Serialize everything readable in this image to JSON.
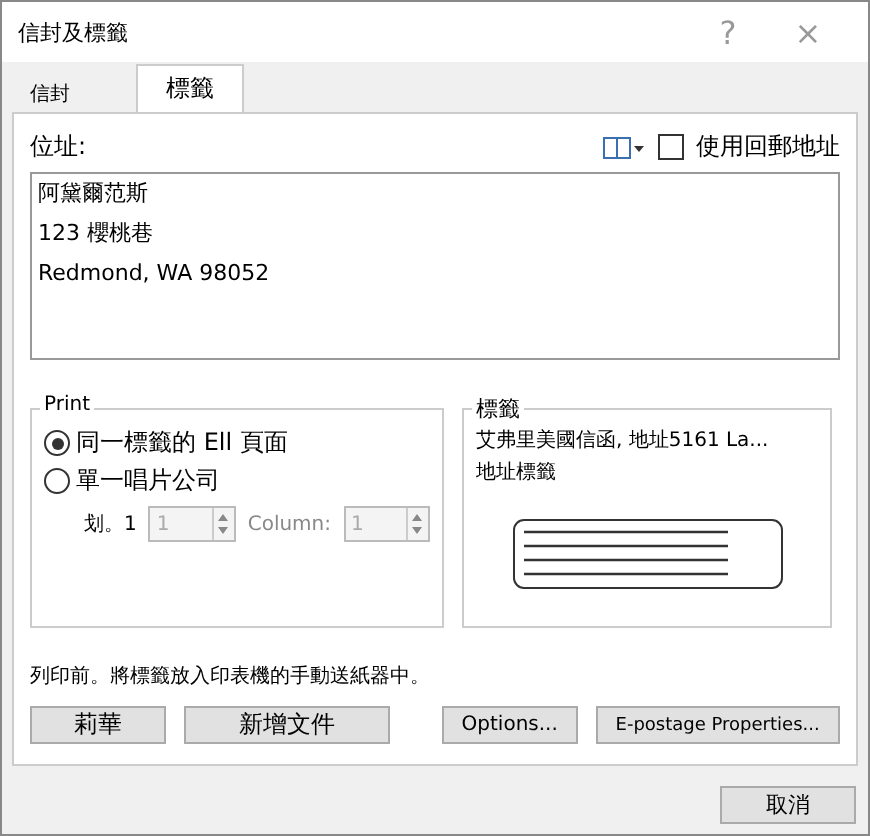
{
  "window": {
    "title": "信封及標籤",
    "help": "?",
    "close": "×"
  },
  "tabs": [
    {
      "label": "信封",
      "selected": false
    },
    {
      "label": "標籤",
      "selected": true
    }
  ],
  "address": {
    "label": "位址:",
    "use_return_address": {
      "label": "使用回郵地址",
      "checked": false
    },
    "lines": [
      "阿黛爾范斯",
      "123 櫻桃巷",
      "Redmond, WA 98052"
    ]
  },
  "print": {
    "title": "Print",
    "options": [
      {
        "label": "同一標籤的 Ell 頁面",
        "selected": true
      },
      {
        "label": "單一唱片公司",
        "selected": false
      }
    ],
    "row": {
      "label": "划。1",
      "value": "1",
      "disabled": true
    },
    "column": {
      "label": "Column:",
      "value": "1",
      "disabled": true
    }
  },
  "label_preview": {
    "title": "標籤",
    "vendor": "艾弗里美國信函, 地址5161 La...",
    "type": "地址標籤"
  },
  "note": "列印前。將標籤放入印表機的手動送紙器中。",
  "buttons": [
    "莉華",
    "新增文件",
    "Options...",
    "E-postage Properties..."
  ],
  "footer_buttons": [
    "取消"
  ]
}
